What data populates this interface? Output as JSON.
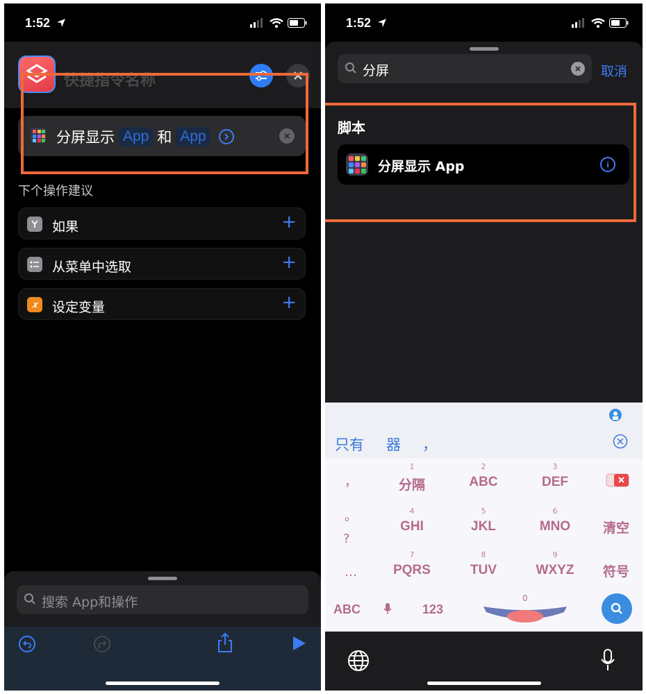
{
  "left": {
    "status": {
      "time": "1:52"
    },
    "header": {
      "shortcut_name": "快捷指令名称"
    },
    "action": {
      "verb": "分屏显示",
      "token1": "App",
      "conj": "和",
      "token2": "App"
    },
    "suggestions": {
      "title": "下个操作建议",
      "items": [
        {
          "label": "如果",
          "icon": "branch-icon",
          "color": "#8e8e93"
        },
        {
          "label": "从菜单中选取",
          "icon": "menu-list-icon",
          "color": "#8e8e93"
        },
        {
          "label": "设定变量",
          "icon": "variable-x-icon",
          "color": "#f08a1c",
          "glyph": "𝑥"
        }
      ]
    },
    "bottom": {
      "search_placeholder": "搜索 App和操作"
    }
  },
  "right": {
    "status": {
      "time": "1:52"
    },
    "search": {
      "value": "分屏",
      "cancel_label": "取消"
    },
    "results": {
      "section_title": "脚本",
      "item_label": "分屏显示 App",
      "info_glyph": "i"
    },
    "keyboard": {
      "candidates": [
        "只有",
        "器",
        "，"
      ],
      "rows": [
        {
          "nums": [
            "1",
            "2",
            "3"
          ],
          "keys": [
            "分隔",
            "ABC",
            "DEF"
          ],
          "left": "，"
        },
        {
          "nums": [
            "4",
            "5",
            "6"
          ],
          "keys": [
            "GHI",
            "JKL",
            "MNO"
          ],
          "left": "。",
          "right": "清空"
        },
        {
          "nums": [
            "7",
            "8",
            "9"
          ],
          "keys": [
            "PQRS",
            "TUV",
            "WXYZ"
          ],
          "left": "…",
          "right": "符号"
        }
      ],
      "left_question": "?",
      "bottom": {
        "abc": "ABC",
        "num": "123",
        "zero": "0"
      }
    }
  },
  "colors": {
    "accent": "#3d7cf5",
    "highlight": "#ee6a3a",
    "key_text": "#b56a8c"
  }
}
